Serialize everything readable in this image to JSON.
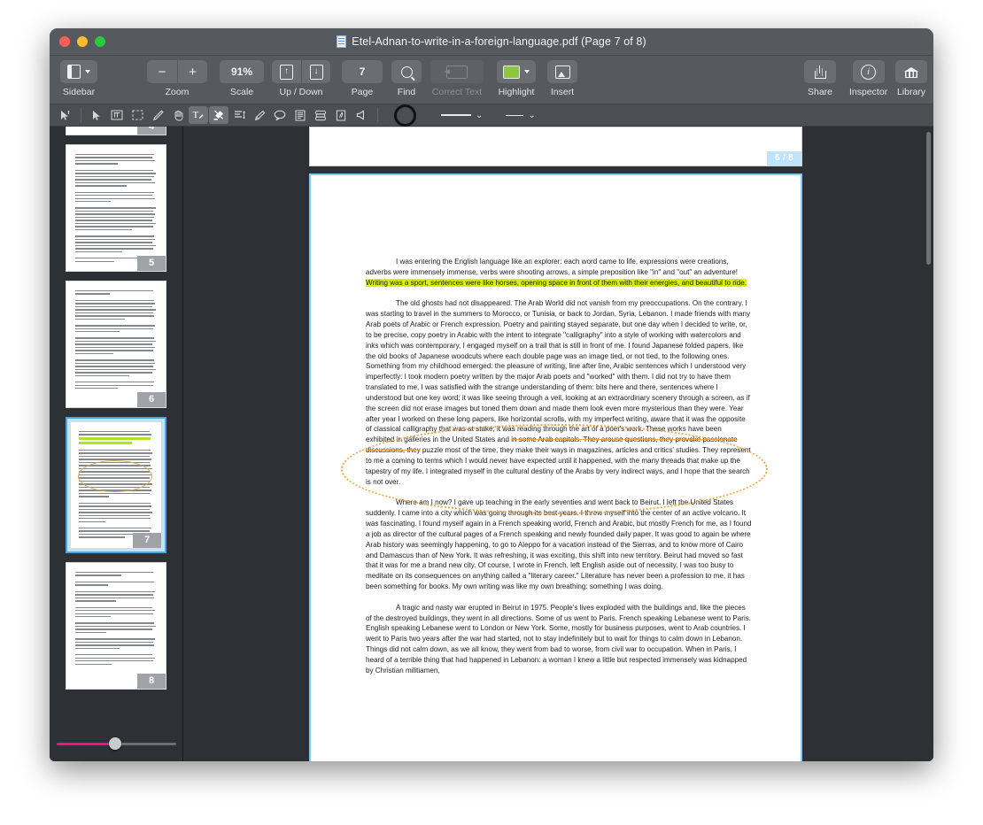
{
  "window": {
    "title": "Etel-Adnan-to-write-in-a-foreign-language.pdf (Page 7 of 8)",
    "title_icon": "pdf-document-icon",
    "traffic_lights": [
      "close",
      "minimize",
      "zoom"
    ]
  },
  "toolbar": {
    "groups": [
      {
        "name": "sidebar",
        "label": "Sidebar",
        "icon": "sidebar-panel-icon",
        "has_chevron": true,
        "disabled": false
      },
      {
        "name": "zoom",
        "label": "Zoom",
        "minus": "−",
        "plus": "+",
        "disabled": false
      },
      {
        "name": "scale",
        "label": "Scale",
        "value": "91%",
        "disabled": false
      },
      {
        "name": "updown",
        "label": "Up / Down",
        "up": "↑",
        "down": "↓",
        "disabled": false
      },
      {
        "name": "page",
        "label": "Page",
        "value": "7",
        "disabled": false
      },
      {
        "name": "find",
        "label": "Find",
        "icon": "magnifier-icon",
        "disabled": false
      },
      {
        "name": "correct-text",
        "label": "Correct Text",
        "icon": "correct-text-icon",
        "disabled": true
      },
      {
        "name": "highlight",
        "label": "Highlight",
        "icon": "color-swatch-icon",
        "swatch_color": "#8ec63f",
        "has_chevron": true,
        "disabled": false
      },
      {
        "name": "insert",
        "label": "Insert",
        "icon": "insert-image-icon",
        "disabled": false
      }
    ],
    "right_groups": [
      {
        "name": "share",
        "label": "Share",
        "icon": "share-icon"
      },
      {
        "name": "inspector",
        "label": "Inspector",
        "icon": "info-circle-icon"
      },
      {
        "name": "library",
        "label": "Library",
        "icon": "library-columns-icon"
      }
    ]
  },
  "annotation_bar": {
    "tools": [
      {
        "name": "text-cursor-select-tool",
        "icon": "text-cursor-icon",
        "active": false
      },
      {
        "name": "arrow-select-tool",
        "icon": "arrow-pointer-icon",
        "active": false
      },
      {
        "name": "text-box-tool",
        "icon": "text-box-icon",
        "active": false
      },
      {
        "name": "marquee-select-tool",
        "icon": "dashed-rectangle-icon",
        "active": false
      },
      {
        "name": "pencil-tool",
        "icon": "pencil-icon",
        "active": false
      },
      {
        "name": "hand-tool",
        "icon": "hand-icon",
        "active": false
      },
      {
        "name": "text-annotate-tool",
        "icon": "text-annotate-icon",
        "active": true
      },
      {
        "name": "highlight-tool",
        "icon": "highlighter-marker-icon",
        "active": true
      },
      {
        "name": "text-align-tool",
        "icon": "text-lines-icon",
        "active": false
      },
      {
        "name": "eraser-tool",
        "icon": "eraser-icon",
        "active": false
      },
      {
        "name": "comment-tool",
        "icon": "speech-bubble-icon",
        "active": false
      },
      {
        "name": "note-tool",
        "icon": "note-lines-icon",
        "active": false
      },
      {
        "name": "stamp-tool",
        "icon": "stamp-icon",
        "active": false
      },
      {
        "name": "signature-tool",
        "icon": "signature-icon",
        "active": false
      },
      {
        "name": "sound-tool",
        "icon": "speaker-icon",
        "active": false
      }
    ],
    "shape_button": {
      "name": "ellipse-shape-button",
      "icon": "circle-outline-icon"
    },
    "line_width": {
      "name": "line-width-dropdown",
      "chevron": "⌄"
    },
    "line_style": {
      "name": "line-style-dropdown",
      "chevron": "⌄"
    }
  },
  "sidebar": {
    "thumbnails": [
      {
        "page": "4",
        "selected": false,
        "partial": true
      },
      {
        "page": "5",
        "selected": false
      },
      {
        "page": "6",
        "selected": false
      },
      {
        "page": "7",
        "selected": true
      },
      {
        "page": "8",
        "selected": false
      }
    ],
    "zoom_slider": {
      "name": "thumbnail-zoom-slider",
      "fill_color": "#e8197d",
      "value": 46
    }
  },
  "pdf_view": {
    "previous_page_badge": "6 / 8",
    "current_page": 7,
    "total_pages": 8,
    "highlight_color": "#d9f10a",
    "ink_color": "#f0a53c",
    "paragraphs": [
      {
        "id": "p1",
        "parts": [
          {
            "text": "I was entering the English language like an explorer: each word came to life, expressions were creations, adverbs were immensely immense, verbs were shooting arrows, a simple preposition like \"in\" and \"out\" an adventure! ",
            "style": "normal"
          },
          {
            "text": "Writing was a sport, sentences were like horses, opening space in front of them with their energies, and beautiful to ride.",
            "style": "highlight"
          }
        ]
      },
      {
        "id": "p2",
        "parts": [
          {
            "text": "The old ghosts had not disappeared. The Arab World did not vanish from my preoccupations. On the contrary. I was starting to travel in the summers to Morocco, or Tunisia, or back to Jordan, Syria, Lebanon. I made friends with many Arab poets of Arabic or French expression. Poetry and painting stayed separate, but one day when I decided to write, or, to be precise, copy poetry in Arabic with the intent to integrate \"calligraphy\" into a style of working with watercolors and inks which was contemporary, I engaged myself on a trail that is still in front of me. I found Japanese folded papers, like the old books of Japanese woodcuts where each double page was an image tied, or not tied, to the following ones. Something from my childhood emerged: the pleasure of writing, line after line, Arabic sentences which I understood very imperfectly: I took modern poetry written by the major Arab poets and \"worked\" with them. I did not try to have them translated to me, I was satisfied with the strange understanding of them: bits here and there, sentences where I understood but one key word; it was like seeing through a veil, looking at an extraordinary scenery through a screen, as if the screen did not erase images but toned them down and made them look even more mysterious than they were. Year after year I worked on these long papers, like horizontal scrolls, with my imperfect writing, aware that it was the opposite of classical calligraphy that was at stake; it was reading through the art of a poet's work. These works have been exhibited in galleries in the United States and ",
            "style": "normal"
          },
          {
            "text": "in some Arab capitals. They arouse questions, they provoke passionate discussions, they",
            "style": "strikethrough"
          },
          {
            "text": " puzzle most of the time, they make their ways in magazines, articles and critics' studies. They represent to me a coming to terms which I would never have expected until it happened, with the many threads that make up the tapestry of my life. I integrated myself in the cultural destiny of the Arabs by very indirect ways, and I hope that the search is not over.",
            "style": "normal"
          }
        ]
      },
      {
        "id": "p3",
        "parts": [
          {
            "text": "Where am I now? I gave up teaching in the early seventies and went back to Beirut. I left the United States suddenly. I came into a city which was going through its best years. I threw myself into the center of an active volcano. It was fascinating. I found myself again in a French speaking world, French and Arabic, but mostly French for me, as I found a job as director of the cultural pages of a French speaking and newly founded daily paper. It was good to again be where Arab history was seemingly happening, to go to Aleppo for a vacation instead of the Sierras, and to know more of Cairo and Damascus than of New York. It was refreshing, it was exciting, this shift into new territory. Beirut had moved so fast that it was for me a brand new city. Of course, I wrote in French, left English aside out of necessity. I was too busy to meditate on its consequences on anything called a \"literary career.\" Literature has never been a profession to me, it has been something for books. My own writing was like my own breathing: something I was doing.",
            "style": "normal"
          }
        ]
      },
      {
        "id": "p4",
        "parts": [
          {
            "text": "A tragic and nasty war erupted in Beirut in 1975. People's lives exploded with the buildings and, like the pieces of the destroyed buildings, they went in all directions. Some of us went to Paris. French speaking Lebanese went to Paris. English speaking Lebanese went to London or New York. Some, mostly for business purposes, went to Arab countries. I went to Paris two years after the war had started, not to stay indefinitely but to wait for things to calm down in Lebanon. Things did not calm down, as we all know, they went from bad to worse, from civil war to occupation. When in Paris, I heard of a terrible thing that had happened in Lebanon: a woman I knew a little but respected immensely was kidnapped by Christian militiamen,",
            "style": "normal"
          }
        ]
      }
    ]
  }
}
